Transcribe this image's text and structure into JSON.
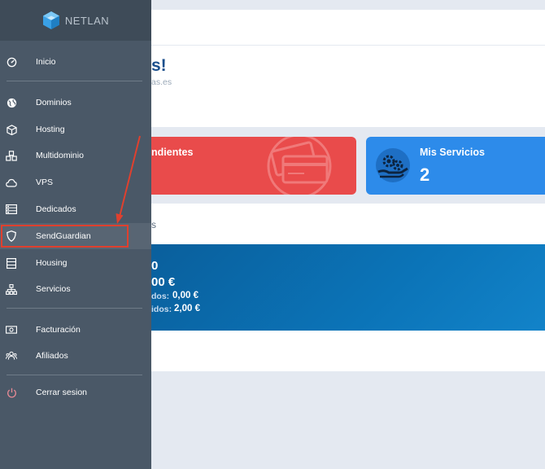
{
  "brand": {
    "name": "NETLAN"
  },
  "sidebar": {
    "items": [
      {
        "label": "Inicio",
        "icon": "dashboard-gauge-icon"
      },
      {
        "label": "Dominios",
        "icon": "globe-icon"
      },
      {
        "label": "Hosting",
        "icon": "cube-icon"
      },
      {
        "label": "Multidominio",
        "icon": "cubes-icon"
      },
      {
        "label": "VPS",
        "icon": "cloud-icon"
      },
      {
        "label": "Dedicados",
        "icon": "server-list-icon"
      },
      {
        "label": "SendGuardian",
        "icon": "shield-icon"
      },
      {
        "label": "Housing",
        "icon": "rack-icon"
      },
      {
        "label": "Servicios",
        "icon": "sitemap-icon"
      },
      {
        "label": "Facturación",
        "icon": "money-bill-icon"
      },
      {
        "label": "Afiliados",
        "icon": "users-icon"
      },
      {
        "label": "Cerrar sesion",
        "icon": "power-icon"
      }
    ]
  },
  "main": {
    "welcome_fragment": "s!",
    "email_fragment": "as.es",
    "cards": {
      "pending": {
        "title": "ndientes"
      },
      "services": {
        "title": "Mis Servicios",
        "value": "2"
      }
    },
    "section_fragment": "s",
    "balance": {
      "top_fragment": "0",
      "total": "00 €",
      "row1_label": "dos:",
      "row1_value": "0,00 €",
      "row2_label": "idos:",
      "row2_value": "2,00 €"
    }
  },
  "colors": {
    "sidebar": "#4a5867",
    "active_item": "#586573",
    "highlight": "#e0402e",
    "card_red": "#e94b4b",
    "card_blue": "#2d8bea",
    "balance": "#0b74b8"
  }
}
